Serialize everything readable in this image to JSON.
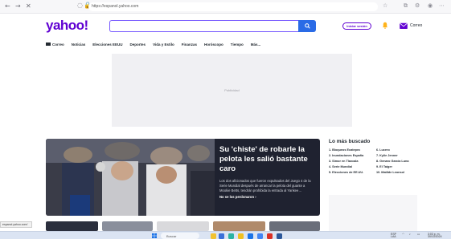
{
  "browser": {
    "url": "https://espanol.yahoo.com"
  },
  "header": {
    "logo": "yahoo!",
    "search_placeholder": "",
    "signin_label": "Iniciar sesión",
    "mail_label": "Correo"
  },
  "nav": {
    "items": [
      "Correo",
      "Noticias",
      "Elecciones EEUU",
      "Deportes",
      "Vida y Estilo",
      "Finanzas",
      "Horóscopo",
      "Tiempo",
      "Más..."
    ]
  },
  "ad": {
    "label": "Publicidad"
  },
  "hero": {
    "title": "Su 'chiste' de robarle la pelota les salió bastante caro",
    "description": "Los dos aficionados que fueron expulsados del Juego 4 de la Serie Mundial después de arrancar la pelota del guante a Mookie Betts, tendrán prohibida la entrada al Yankee…",
    "link": "No se los perdonaron ›"
  },
  "trending": {
    "title": "Lo más buscado",
    "items": [
      {
        "num": "1.",
        "label": "Bloqueos Ecatepec"
      },
      {
        "num": "6.",
        "label": "Lucero"
      },
      {
        "num": "2.",
        "label": "Inundaciones España"
      },
      {
        "num": "7.",
        "label": "Kylie Jenner"
      },
      {
        "num": "3.",
        "label": "Simor en Tlaxcala"
      },
      {
        "num": "8.",
        "label": "Genaro García Luna"
      },
      {
        "num": "4.",
        "label": "Serie Mundial"
      },
      {
        "num": "9.",
        "label": "El Taiger"
      },
      {
        "num": "5.",
        "label": "Elecciones de EE.UU."
      },
      {
        "num": "10.",
        "label": "Matilde Leonsol"
      }
    ]
  },
  "status": {
    "tooltip": "espanol.yahoo.com/"
  },
  "taskbar": {
    "search_label": "Buscar",
    "lang": "ESP\nLAA",
    "time": "3:03 p. m.\n30/10/2024"
  },
  "colors": {
    "brand": "#6001d2",
    "search_button": "#2a6be6",
    "hero_bg": "#1f2230"
  }
}
